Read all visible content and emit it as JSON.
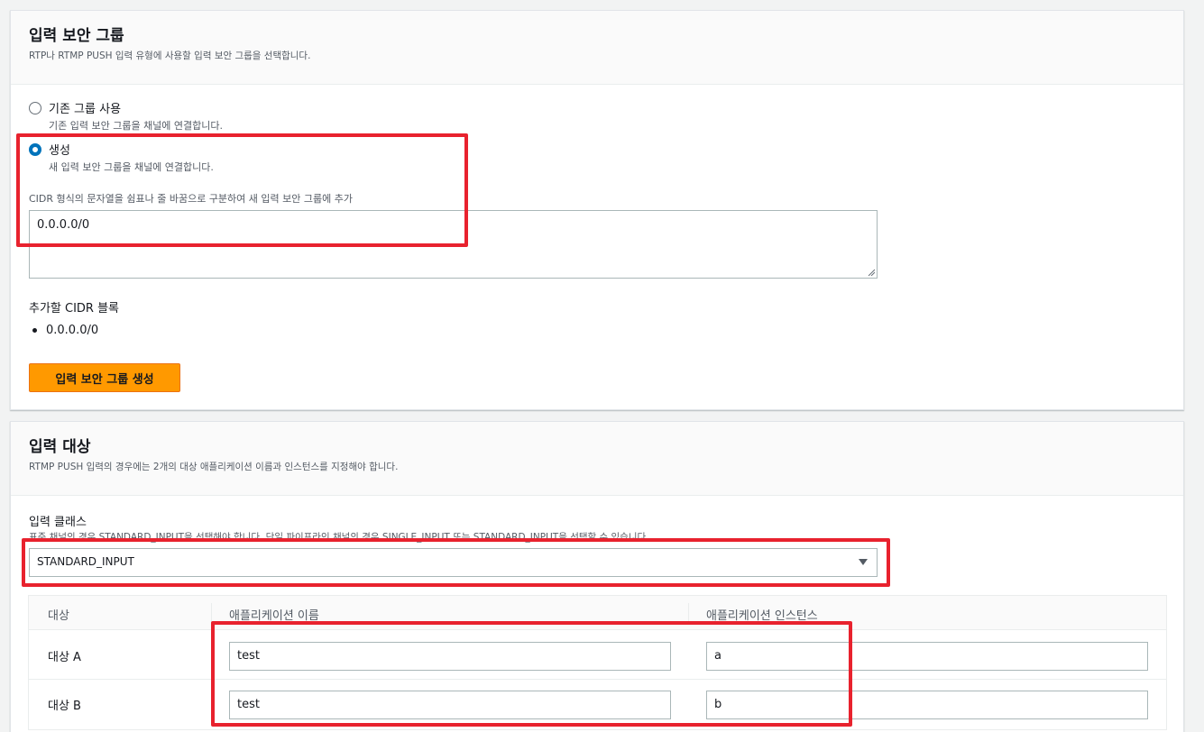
{
  "security_group": {
    "title": "입력 보안 그룹",
    "description": "RTP나 RTMP PUSH 입력 유형에 사용할 입력 보안 그룹을 선택합니다.",
    "option_existing": {
      "label": "기존 그룹 사용",
      "description": "기존 입력 보안 그룹을 채널에 연결합니다.",
      "selected": false
    },
    "option_create": {
      "label": "생성",
      "description": "새 입력 보안 그룹을 채널에 연결합니다.",
      "selected": true
    },
    "cidr_label": "CIDR 형식의 문자열을 쉼표나 줄 바꿈으로 구분하여 새 입력 보안 그룹에 추가",
    "cidr_value": "0.0.0.0/0",
    "cidr_blocks_title": "추가할 CIDR 블록",
    "cidr_blocks": [
      "0.0.0.0/0"
    ],
    "create_button": "입력 보안 그룹 생성"
  },
  "input_destinations": {
    "title": "입력 대상",
    "description": "RTMP PUSH 입력의 경우에는 2개의 대상 애플리케이션 이름과 인스턴스를 지정해야 합니다.",
    "input_class_label": "입력 클래스",
    "input_class_hint": "표준 채널의 경우 STANDARD_INPUT을 선택해야 합니다. 단일 파이프라인 채널의 경우 SINGLE_INPUT 또는 STANDARD_INPUT을 선택할 수 있습니다.",
    "input_class_value": "STANDARD_INPUT",
    "table": {
      "columns": [
        "대상",
        "애플리케이션 이름",
        "애플리케이션 인스턴스"
      ],
      "rows": [
        {
          "target": "대상 A",
          "app_name": "test",
          "app_instance": "a"
        },
        {
          "target": "대상 B",
          "app_name": "test",
          "app_instance": "b"
        }
      ]
    }
  },
  "colors": {
    "accent": "#0073bb",
    "primary_button": "#ff9900",
    "highlight_box": "#e8222e"
  }
}
